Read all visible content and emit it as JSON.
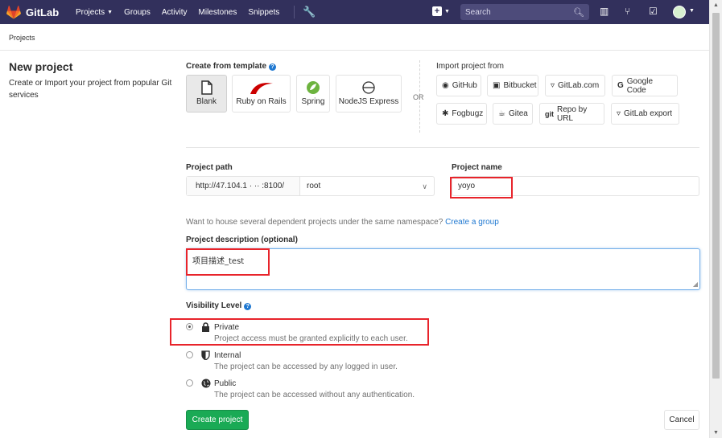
{
  "colors": {
    "nav_bg": "#32305c",
    "accent_blue": "#1f78d1",
    "success_green": "#1aaa55",
    "annotation_red": "#e8242b"
  },
  "nav": {
    "brand": "GitLab",
    "links": [
      {
        "label": "Projects",
        "dropdown": true
      },
      {
        "label": "Groups",
        "dropdown": false
      },
      {
        "label": "Activity",
        "dropdown": false
      },
      {
        "label": "Milestones",
        "dropdown": false
      },
      {
        "label": "Snippets",
        "dropdown": false
      }
    ],
    "admin_icon": "wrench-icon",
    "new_icon": "plus-square-icon",
    "search_placeholder": "Search",
    "search_icon": "search-icon",
    "right_icons": [
      "sidebar-toggle-icon",
      "merge-request-icon",
      "todo-check-icon"
    ],
    "avatar_icon": "user-avatar"
  },
  "breadcrumb": "Projects",
  "left": {
    "title": "New project",
    "description": "Create or Import your project from popular Git services"
  },
  "templates": {
    "heading": "Create from template",
    "items": [
      {
        "label": "Blank",
        "icon": "blank-file-icon",
        "active": true
      },
      {
        "label": "Ruby on Rails",
        "icon": "rails-icon",
        "active": false
      },
      {
        "label": "Spring",
        "icon": "spring-icon",
        "active": false
      },
      {
        "label": "NodeJS Express",
        "icon": "express-icon",
        "active": false
      }
    ]
  },
  "or_label": "OR",
  "import": {
    "heading": "Import project from",
    "sources": [
      {
        "label": "GitHub",
        "icon": "github-icon"
      },
      {
        "label": "Bitbucket",
        "icon": "bitbucket-icon"
      },
      {
        "label": "GitLab.com",
        "icon": "gitlab-icon"
      },
      {
        "label": "Google Code",
        "icon": "google-icon"
      },
      {
        "label": "Fogbugz",
        "icon": "bug-icon"
      },
      {
        "label": "Gitea",
        "icon": "gitea-icon"
      },
      {
        "label": "Repo by URL",
        "icon": "git-icon"
      },
      {
        "label": "GitLab export",
        "icon": "gitlab-icon"
      }
    ]
  },
  "project_path": {
    "label": "Project path",
    "prefix": "http://47.104.1 ·  ·· :8100/",
    "namespace": "root"
  },
  "project_name": {
    "label": "Project name",
    "value": "yoyo"
  },
  "namespace_help": {
    "text": "Want to house several dependent projects under the same namespace?",
    "link": "Create a group"
  },
  "description": {
    "label": "Project description (optional)",
    "value": "项目描述_test"
  },
  "visibility": {
    "label": "Visibility Level",
    "options": [
      {
        "name": "Private",
        "desc": "Project access must be granted explicitly to each user.",
        "icon": "lock-icon",
        "checked": true
      },
      {
        "name": "Internal",
        "desc": "The project can be accessed by any logged in user.",
        "icon": "shield-icon",
        "checked": false
      },
      {
        "name": "Public",
        "desc": "The project can be accessed without any authentication.",
        "icon": "globe-icon",
        "checked": false
      }
    ]
  },
  "actions": {
    "create": "Create project",
    "cancel": "Cancel"
  }
}
